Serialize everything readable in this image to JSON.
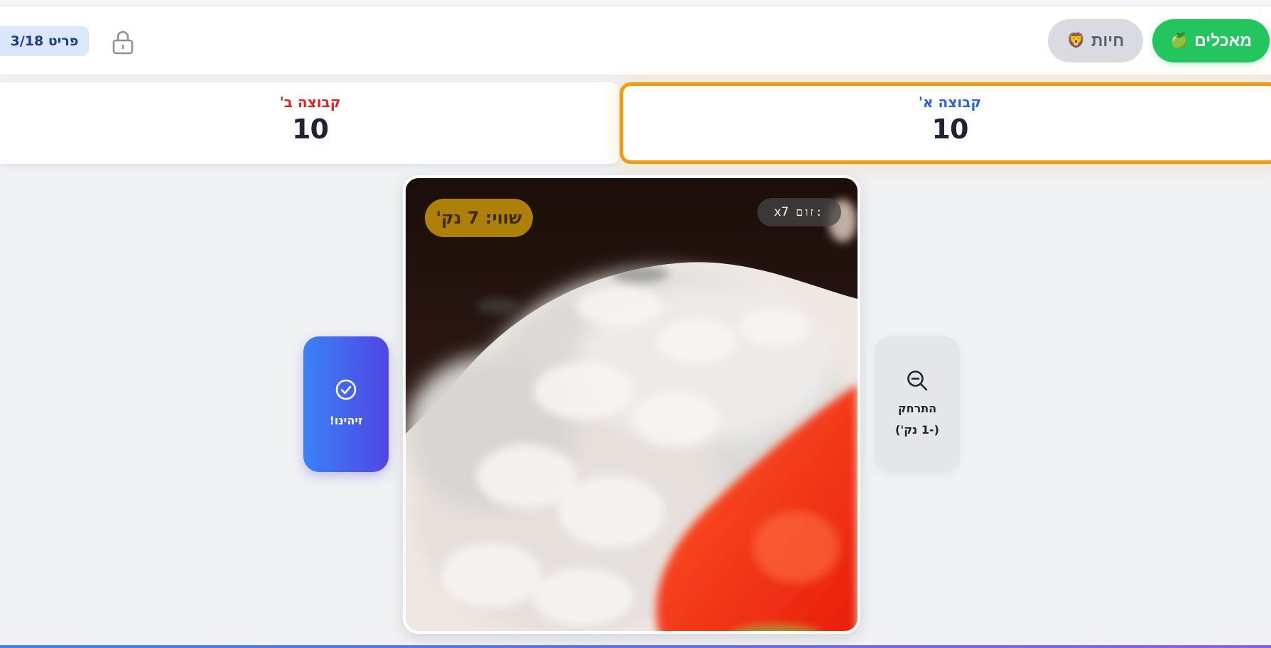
{
  "header": {
    "categories": [
      {
        "label": "מאכלים",
        "emoji": "🍏",
        "active": true
      },
      {
        "label": "חיות",
        "emoji": "🦁",
        "active": false
      }
    ],
    "lock_icon": "lock-icon",
    "item_counter": "פריט 3/18"
  },
  "teams": [
    {
      "name": "קבוצה א'",
      "score": "10",
      "active": true,
      "color": "#2b63d9"
    },
    {
      "name": "קבוצה ב'",
      "score": "10",
      "active": false,
      "color": "#dc2626"
    }
  ],
  "image": {
    "worth_label": "שווי: 7 נק'",
    "zoom_label": "זום:",
    "zoom_value": "x7"
  },
  "actions": {
    "identified_label": "זיהינו!",
    "identified_icon": "check-circle-icon",
    "zoom_out_line1": "התרחק",
    "zoom_out_line2": "(-1 נק')",
    "zoom_out_icon": "zoom-out-icon"
  },
  "colors": {
    "food_active": "#22c55e",
    "active_team_border": "#f29b10",
    "identified_gradient": [
      "#3b82f6",
      "#4f46e5"
    ],
    "worth_badge": "#b98a0a"
  }
}
